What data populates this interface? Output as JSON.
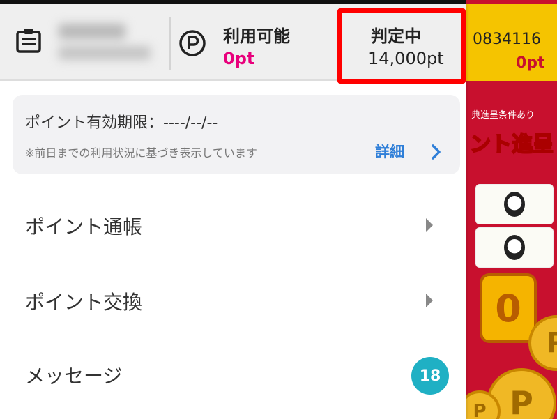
{
  "header": {
    "usable_label": "利用可能",
    "usable_value": "0pt",
    "pending_label": "判定中",
    "pending_value": "14,000pt"
  },
  "expiry": {
    "title": "ポイント有効期限：----/--/--",
    "note": "※前日までの利用状況に基づき表示しています",
    "detail_label": "詳細"
  },
  "menu": [
    {
      "label": "ポイント通帳"
    },
    {
      "label": "ポイント交換"
    },
    {
      "label": "メッセージ",
      "badge": "18"
    }
  ],
  "background_app": {
    "number": "0834116",
    "points": "0pt",
    "condition_text": "典進呈条件あり",
    "banner_text": "ント進呈",
    "zero_counter": "0"
  },
  "colors": {
    "accent_pink": "#e8007c",
    "link_blue": "#2f7fd8",
    "badge_teal": "#1fb0c4",
    "highlight_red": "#ff0000",
    "background_red": "#c8102e",
    "background_yellow": "#f5c400"
  },
  "icons": {
    "member": "member-card-icon",
    "point": "point-p-icon",
    "chevron": "chevron-right-icon",
    "menu_arrow": "triangle-right-icon"
  }
}
